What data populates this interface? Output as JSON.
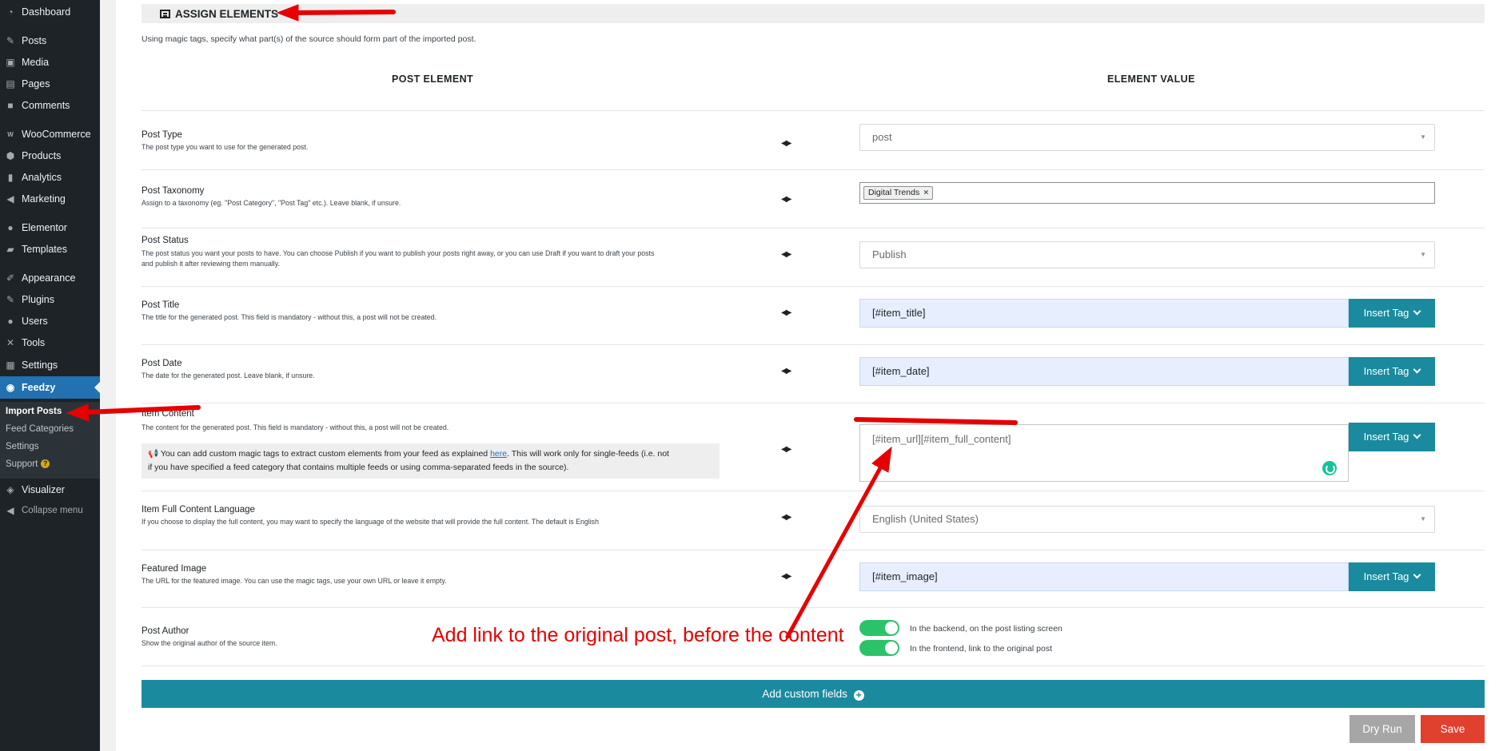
{
  "sidebar": {
    "items": [
      {
        "label": "Dashboard",
        "icon": "dashboard-icon"
      },
      {
        "label": "Posts",
        "icon": "pin-icon"
      },
      {
        "label": "Media",
        "icon": "media-icon"
      },
      {
        "label": "Pages",
        "icon": "pages-icon"
      },
      {
        "label": "Comments",
        "icon": "comment-icon"
      },
      {
        "label": "WooCommerce",
        "icon": "woocommerce-icon"
      },
      {
        "label": "Products",
        "icon": "box-icon"
      },
      {
        "label": "Analytics",
        "icon": "bar-chart-icon"
      },
      {
        "label": "Marketing",
        "icon": "megaphone-icon"
      },
      {
        "label": "Elementor",
        "icon": "elementor-icon"
      },
      {
        "label": "Templates",
        "icon": "folder-icon"
      },
      {
        "label": "Appearance",
        "icon": "brush-icon"
      },
      {
        "label": "Plugins",
        "icon": "plug-icon"
      },
      {
        "label": "Users",
        "icon": "user-icon"
      },
      {
        "label": "Tools",
        "icon": "wrench-icon"
      },
      {
        "label": "Settings",
        "icon": "sliders-icon"
      },
      {
        "label": "Feedzy",
        "icon": "feed-icon"
      },
      {
        "label": "Visualizer",
        "icon": "chart-icon"
      }
    ],
    "submenu": [
      {
        "label": "Import Posts"
      },
      {
        "label": "Feed Categories"
      },
      {
        "label": "Settings"
      },
      {
        "label": "Support",
        "badge": "?"
      }
    ],
    "collapse_label": "Collapse menu"
  },
  "header": {
    "title": "ASSIGN ELEMENTS",
    "intro": "Using magic tags, specify what part(s) of the source should form part of the imported post."
  },
  "columns": {
    "left": "POST ELEMENT",
    "right": "ELEMENT VALUE"
  },
  "arrows_glyph": "◀▶",
  "rows": {
    "post_type": {
      "label": "Post Type",
      "desc": "The post type you want to use for the generated post.",
      "value": "post"
    },
    "post_taxonomy": {
      "label": "Post Taxonomy",
      "desc": "Assign to a taxonomy (eg. \"Post Category\", \"Post Tag\" etc.). Leave blank, if unsure.",
      "chip": "Digital Trends",
      "chip_remove": "×"
    },
    "post_status": {
      "label": "Post Status",
      "desc1": "The post status you want your posts to have. You can choose Publish if you want to publish your posts right away, or you can use Draft if you want to draft your posts",
      "desc2": "and publish it after reviewing them manually.",
      "value": "Publish"
    },
    "post_title": {
      "label": "Post Title",
      "desc": "The title for the generated post. This field is mandatory - without this, a post will not be created.",
      "value": "[#item_title]"
    },
    "post_date": {
      "label": "Post Date",
      "desc": "The date for the generated post. Leave blank, if unsure.",
      "value": "[#item_date]"
    },
    "item_content": {
      "label": "Item Content",
      "desc": "The content for the generated post. This field is mandatory - without this, a post will not be created.",
      "value": "[#item_url][#item_full_content]",
      "note_before": "You can add custom magic tags to extract custom elements from your feed as explained ",
      "note_link": "here",
      "note_after": ". This will work only for single-feeds (i.e. not",
      "note_line2": "if you have specified a feed category that contains multiple feeds or using comma-separated feeds in the source)."
    },
    "full_content_language": {
      "label": "Item Full Content Language",
      "desc": "If you choose to display the full content, you may want to specify the language of the website that will provide the full content. The default is English",
      "value": "English (United States)"
    },
    "featured_image": {
      "label": "Featured Image",
      "desc": "The URL for the featured image. You can use the magic tags, use your own URL or leave it empty.",
      "value": "[#item_image]"
    },
    "post_author": {
      "label": "Post Author",
      "desc": "Show the original author of the source item.",
      "toggle_backend": "In the backend, on the post listing screen",
      "toggle_frontend": "In the frontend, link to the original post",
      "backend_on": true,
      "frontend_on": true
    }
  },
  "insert_tag_label": "Insert Tag",
  "buttons": {
    "add_custom_fields": "Add custom fields",
    "dry_run": "Dry Run",
    "save": "Save"
  },
  "annotation": "Add link to the original post, before the content",
  "colors": {
    "sidebar_bg": "#1d2327",
    "active_menu": "#2271b1",
    "accent_teal": "#1a8a9e",
    "save_red": "#e2402f",
    "annotation_red": "#e60000",
    "toggle_green": "#2bc36a"
  }
}
